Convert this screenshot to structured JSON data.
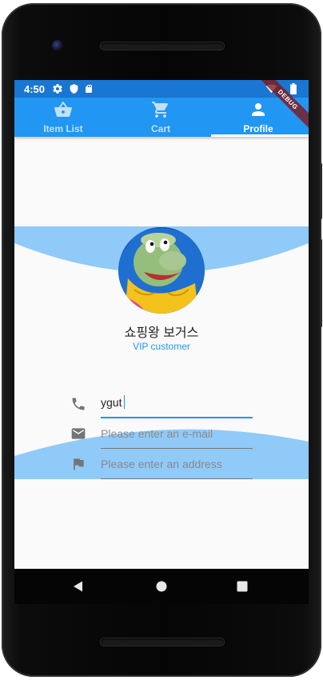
{
  "status_bar": {
    "time": "4:50",
    "icons": [
      "settings-icon",
      "shield-icon",
      "sd-card-icon",
      "wifi-icon",
      "battery-icon"
    ]
  },
  "debug_banner": "DEBUG",
  "tabs": [
    {
      "label": "Item List",
      "icon": "shopping-basket-icon",
      "selected": false
    },
    {
      "label": "Cart",
      "icon": "cart-icon",
      "selected": false
    },
    {
      "label": "Profile",
      "icon": "person-icon",
      "selected": true
    }
  ],
  "profile": {
    "name": "쇼핑왕 보거스",
    "subtitle": "VIP customer",
    "avatar": "cartoon-character-avatar"
  },
  "form": {
    "phone": {
      "value": "ygut",
      "placeholder": "",
      "icon": "phone-icon"
    },
    "email": {
      "value": "",
      "placeholder": "Please enter an e-mail",
      "icon": "email-icon"
    },
    "address": {
      "value": "",
      "placeholder": "Please enter an address",
      "icon": "flag-icon"
    }
  },
  "colors": {
    "status_bar": "#1976d2",
    "app_bar": "#2196f3",
    "accent": "#2196f3",
    "wave": "#90caf9",
    "background": "#fafafa"
  },
  "system_nav": [
    "back-icon",
    "home-icon",
    "recents-icon"
  ]
}
